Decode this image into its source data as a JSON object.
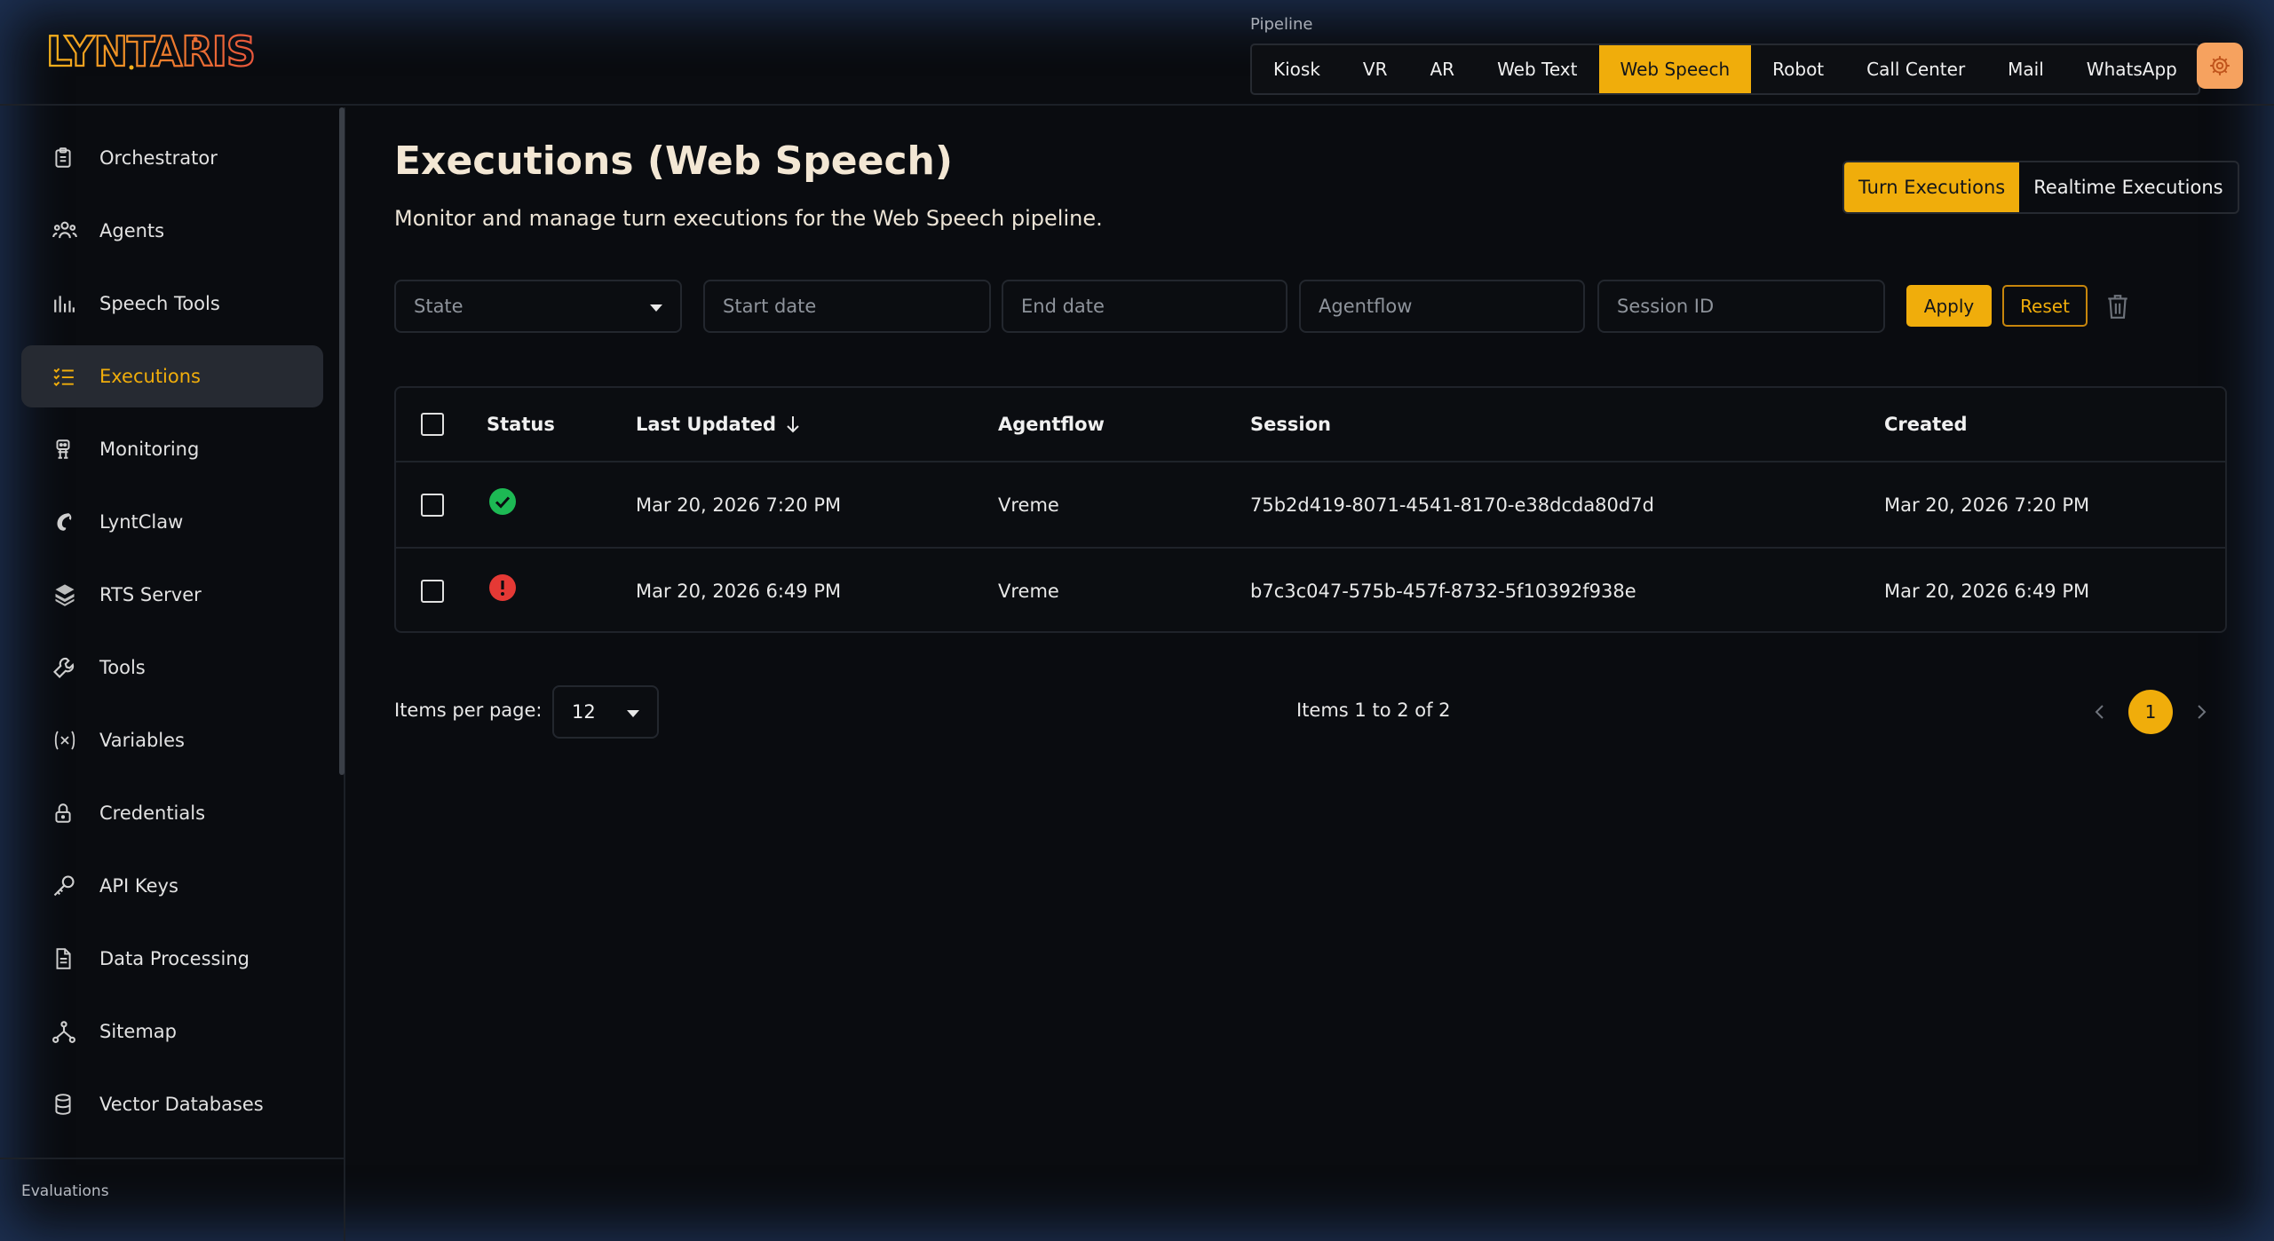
{
  "brand": {
    "logo_text": "LYNTARIS"
  },
  "pipeline": {
    "label": "Pipeline",
    "tabs": [
      "Kiosk",
      "VR",
      "AR",
      "Web Text",
      "Web Speech",
      "Robot",
      "Call Center",
      "Mail",
      "WhatsApp"
    ],
    "active": "Web Speech"
  },
  "colors": {
    "accent": "#f0ad0b",
    "settings": "#f6a25f",
    "success": "#1db954",
    "error": "#e53935"
  },
  "sidebar": {
    "items": [
      {
        "label": "Orchestrator",
        "icon": "clipboard-icon"
      },
      {
        "label": "Agents",
        "icon": "users-icon"
      },
      {
        "label": "Speech Tools",
        "icon": "bar-chart-icon"
      },
      {
        "label": "Executions",
        "icon": "list-check-icon",
        "active": true
      },
      {
        "label": "Monitoring",
        "icon": "robot-icon"
      },
      {
        "label": "LyntClaw",
        "icon": "claw-icon"
      },
      {
        "label": "RTS Server",
        "icon": "server-icon"
      },
      {
        "label": "Tools",
        "icon": "wrench-icon"
      },
      {
        "label": "Variables",
        "icon": "variable-icon"
      },
      {
        "label": "Credentials",
        "icon": "lock-icon"
      },
      {
        "label": "API Keys",
        "icon": "key-icon"
      },
      {
        "label": "Data Processing",
        "icon": "document-icon"
      },
      {
        "label": "Sitemap",
        "icon": "sitemap-icon"
      },
      {
        "label": "Vector Databases",
        "icon": "database-icon"
      }
    ],
    "section": "Evaluations"
  },
  "main": {
    "title": "Executions (Web Speech)",
    "subtitle": "Monitor and manage turn executions for the Web Speech pipeline.",
    "view_toggle": {
      "turn": "Turn Executions",
      "realtime": "Realtime Executions"
    },
    "filters": {
      "state_placeholder": "State",
      "start_placeholder": "Start date",
      "end_placeholder": "End date",
      "agentflow_placeholder": "Agentflow",
      "session_placeholder": "Session ID",
      "apply": "Apply",
      "reset": "Reset"
    },
    "table": {
      "headers": {
        "status": "Status",
        "last_updated": "Last Updated",
        "agentflow": "Agentflow",
        "session": "Session",
        "created": "Created"
      },
      "rows": [
        {
          "status": "success",
          "last_updated": "Mar 20, 2026 7:20 PM",
          "agentflow": "Vreme",
          "session": "75b2d419-8071-4541-8170-e38dcda80d7d",
          "created": "Mar 20, 2026 7:20 PM"
        },
        {
          "status": "error",
          "last_updated": "Mar 20, 2026 6:49 PM",
          "agentflow": "Vreme",
          "session": "b7c3c047-575b-457f-8732-5f10392f938e",
          "created": "Mar 20, 2026 6:49 PM"
        }
      ]
    },
    "pagination": {
      "items_per_page_label": "Items per page:",
      "items_per_page": "12",
      "info": "Items 1 to 2 of 2",
      "current_page": "1"
    }
  }
}
